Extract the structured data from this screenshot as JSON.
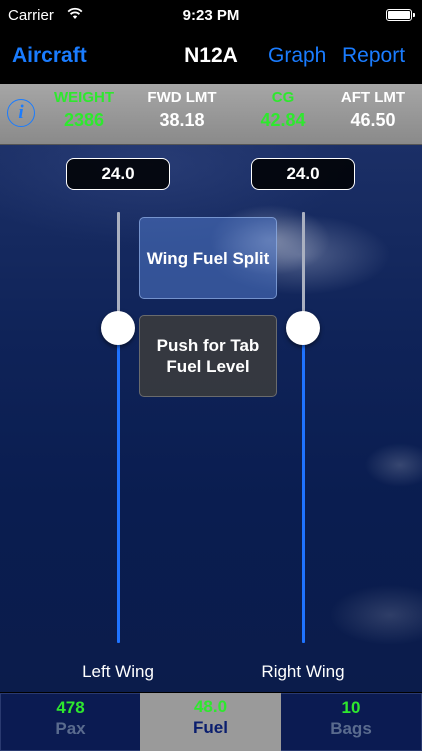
{
  "status": {
    "carrier": "Carrier",
    "time": "9:23 PM"
  },
  "nav": {
    "left": "Aircraft",
    "title": "N12A",
    "graph": "Graph",
    "report": "Report"
  },
  "summary": {
    "weight_label": "WEIGHT",
    "weight_value": "2386",
    "fwd_label": "FWD LMT",
    "fwd_value": "38.18",
    "cg_label": "CG",
    "cg_value": "42.84",
    "aft_label": "AFT LMT",
    "aft_value": "46.50",
    "value_color_ok": "#2ee82e"
  },
  "fuel": {
    "left_value": "24.0",
    "right_value": "24.0",
    "left_level_fraction": 0.75,
    "right_level_fraction": 0.75,
    "split_button": "Wing Fuel Split",
    "tab_button": "Push for Tab Fuel Level",
    "left_label": "Left Wing",
    "right_label": "Right Wing"
  },
  "tabs": [
    {
      "value": "478",
      "name": "Pax"
    },
    {
      "value": "48.0",
      "name": "Fuel"
    },
    {
      "value": "10",
      "name": "Bags"
    }
  ],
  "colors": {
    "accent": "#1a7cff",
    "slider_fill": "#1f73ff",
    "value_green": "#2ee82e"
  }
}
